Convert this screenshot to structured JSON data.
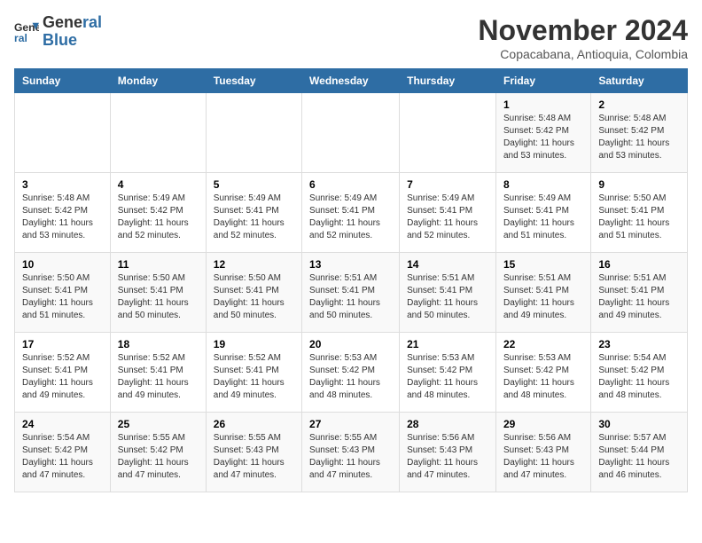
{
  "header": {
    "logo_line1": "General",
    "logo_line2": "Blue",
    "month_year": "November 2024",
    "location": "Copacabana, Antioquia, Colombia"
  },
  "weekdays": [
    "Sunday",
    "Monday",
    "Tuesday",
    "Wednesday",
    "Thursday",
    "Friday",
    "Saturday"
  ],
  "weeks": [
    [
      {
        "day": "",
        "info": ""
      },
      {
        "day": "",
        "info": ""
      },
      {
        "day": "",
        "info": ""
      },
      {
        "day": "",
        "info": ""
      },
      {
        "day": "",
        "info": ""
      },
      {
        "day": "1",
        "info": "Sunrise: 5:48 AM\nSunset: 5:42 PM\nDaylight: 11 hours\nand 53 minutes."
      },
      {
        "day": "2",
        "info": "Sunrise: 5:48 AM\nSunset: 5:42 PM\nDaylight: 11 hours\nand 53 minutes."
      }
    ],
    [
      {
        "day": "3",
        "info": "Sunrise: 5:48 AM\nSunset: 5:42 PM\nDaylight: 11 hours\nand 53 minutes."
      },
      {
        "day": "4",
        "info": "Sunrise: 5:49 AM\nSunset: 5:42 PM\nDaylight: 11 hours\nand 52 minutes."
      },
      {
        "day": "5",
        "info": "Sunrise: 5:49 AM\nSunset: 5:41 PM\nDaylight: 11 hours\nand 52 minutes."
      },
      {
        "day": "6",
        "info": "Sunrise: 5:49 AM\nSunset: 5:41 PM\nDaylight: 11 hours\nand 52 minutes."
      },
      {
        "day": "7",
        "info": "Sunrise: 5:49 AM\nSunset: 5:41 PM\nDaylight: 11 hours\nand 52 minutes."
      },
      {
        "day": "8",
        "info": "Sunrise: 5:49 AM\nSunset: 5:41 PM\nDaylight: 11 hours\nand 51 minutes."
      },
      {
        "day": "9",
        "info": "Sunrise: 5:50 AM\nSunset: 5:41 PM\nDaylight: 11 hours\nand 51 minutes."
      }
    ],
    [
      {
        "day": "10",
        "info": "Sunrise: 5:50 AM\nSunset: 5:41 PM\nDaylight: 11 hours\nand 51 minutes."
      },
      {
        "day": "11",
        "info": "Sunrise: 5:50 AM\nSunset: 5:41 PM\nDaylight: 11 hours\nand 50 minutes."
      },
      {
        "day": "12",
        "info": "Sunrise: 5:50 AM\nSunset: 5:41 PM\nDaylight: 11 hours\nand 50 minutes."
      },
      {
        "day": "13",
        "info": "Sunrise: 5:51 AM\nSunset: 5:41 PM\nDaylight: 11 hours\nand 50 minutes."
      },
      {
        "day": "14",
        "info": "Sunrise: 5:51 AM\nSunset: 5:41 PM\nDaylight: 11 hours\nand 50 minutes."
      },
      {
        "day": "15",
        "info": "Sunrise: 5:51 AM\nSunset: 5:41 PM\nDaylight: 11 hours\nand 49 minutes."
      },
      {
        "day": "16",
        "info": "Sunrise: 5:51 AM\nSunset: 5:41 PM\nDaylight: 11 hours\nand 49 minutes."
      }
    ],
    [
      {
        "day": "17",
        "info": "Sunrise: 5:52 AM\nSunset: 5:41 PM\nDaylight: 11 hours\nand 49 minutes."
      },
      {
        "day": "18",
        "info": "Sunrise: 5:52 AM\nSunset: 5:41 PM\nDaylight: 11 hours\nand 49 minutes."
      },
      {
        "day": "19",
        "info": "Sunrise: 5:52 AM\nSunset: 5:41 PM\nDaylight: 11 hours\nand 49 minutes."
      },
      {
        "day": "20",
        "info": "Sunrise: 5:53 AM\nSunset: 5:42 PM\nDaylight: 11 hours\nand 48 minutes."
      },
      {
        "day": "21",
        "info": "Sunrise: 5:53 AM\nSunset: 5:42 PM\nDaylight: 11 hours\nand 48 minutes."
      },
      {
        "day": "22",
        "info": "Sunrise: 5:53 AM\nSunset: 5:42 PM\nDaylight: 11 hours\nand 48 minutes."
      },
      {
        "day": "23",
        "info": "Sunrise: 5:54 AM\nSunset: 5:42 PM\nDaylight: 11 hours\nand 48 minutes."
      }
    ],
    [
      {
        "day": "24",
        "info": "Sunrise: 5:54 AM\nSunset: 5:42 PM\nDaylight: 11 hours\nand 47 minutes."
      },
      {
        "day": "25",
        "info": "Sunrise: 5:55 AM\nSunset: 5:42 PM\nDaylight: 11 hours\nand 47 minutes."
      },
      {
        "day": "26",
        "info": "Sunrise: 5:55 AM\nSunset: 5:43 PM\nDaylight: 11 hours\nand 47 minutes."
      },
      {
        "day": "27",
        "info": "Sunrise: 5:55 AM\nSunset: 5:43 PM\nDaylight: 11 hours\nand 47 minutes."
      },
      {
        "day": "28",
        "info": "Sunrise: 5:56 AM\nSunset: 5:43 PM\nDaylight: 11 hours\nand 47 minutes."
      },
      {
        "day": "29",
        "info": "Sunrise: 5:56 AM\nSunset: 5:43 PM\nDaylight: 11 hours\nand 47 minutes."
      },
      {
        "day": "30",
        "info": "Sunrise: 5:57 AM\nSunset: 5:44 PM\nDaylight: 11 hours\nand 46 minutes."
      }
    ]
  ]
}
